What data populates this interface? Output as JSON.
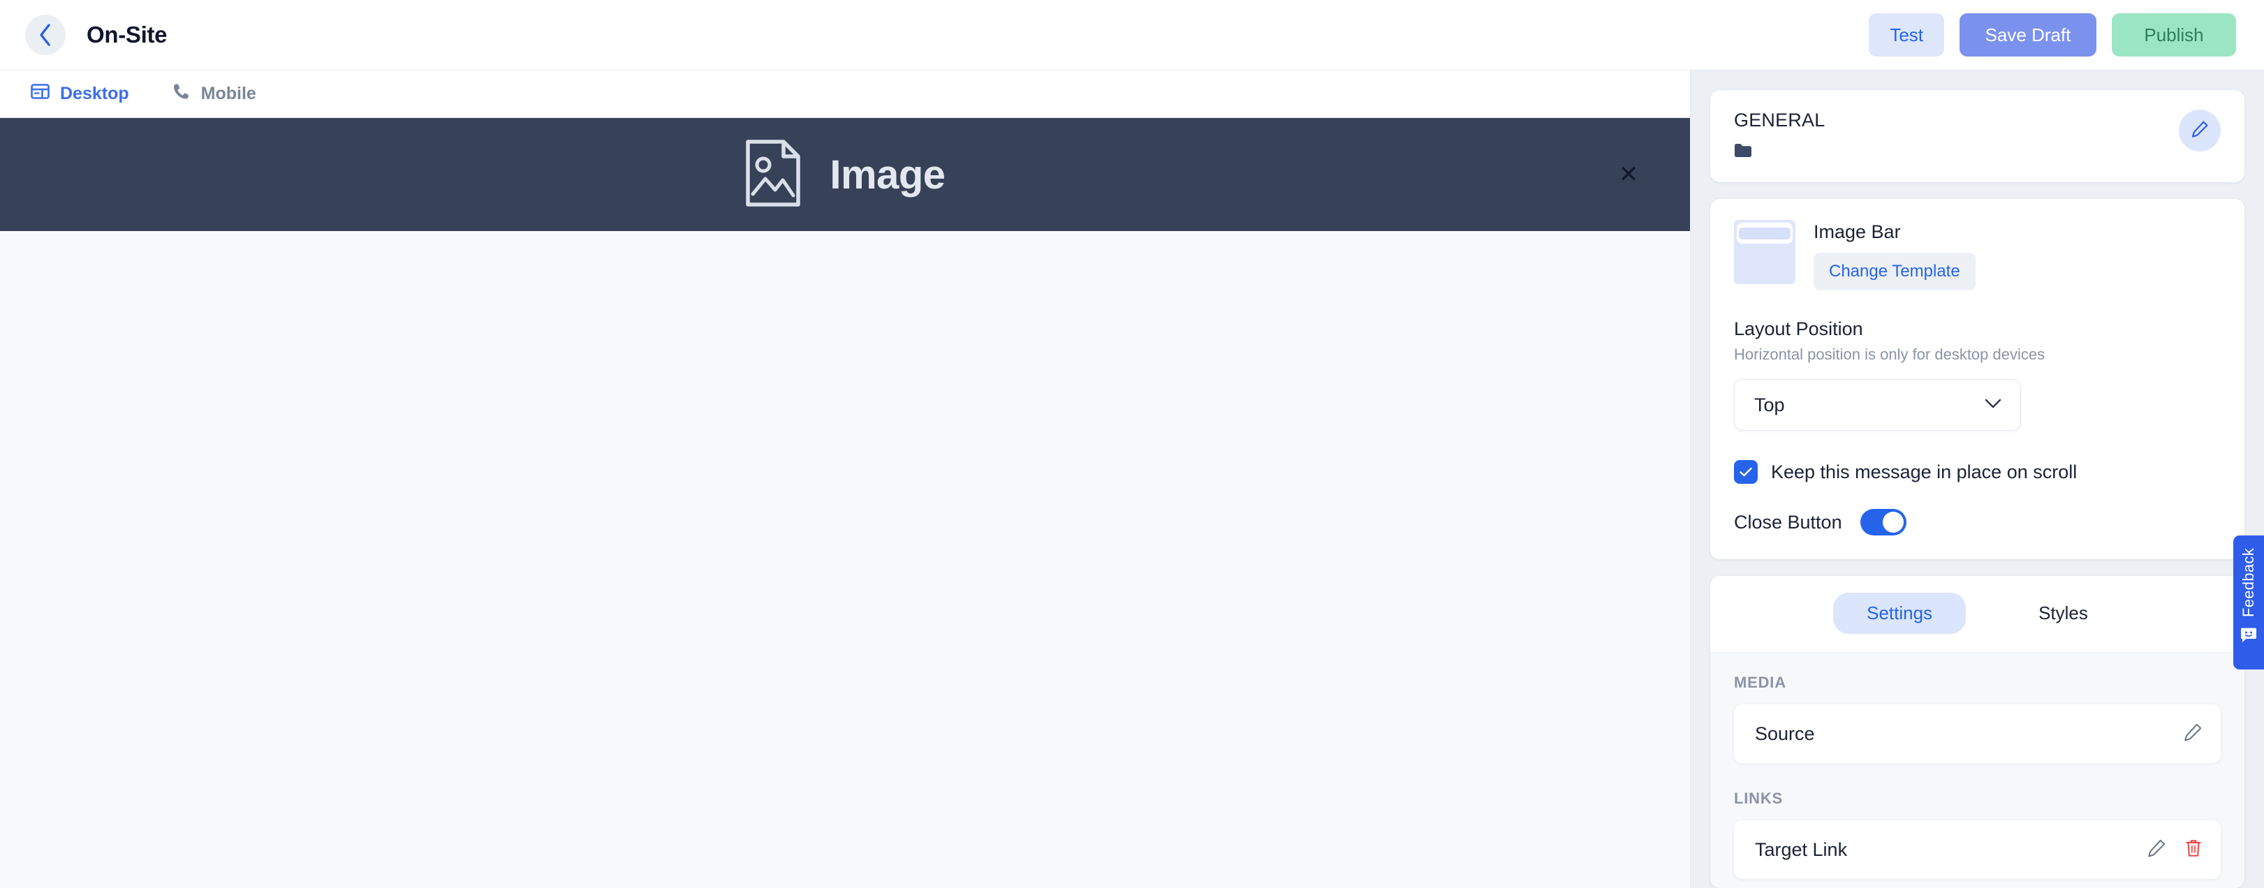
{
  "topbar": {
    "back_icon": "chevron-left-icon",
    "title": "On-Site",
    "buttons": {
      "test": "Test",
      "save_draft": "Save Draft",
      "publish": "Publish"
    }
  },
  "device_tabs": [
    {
      "label": "Desktop",
      "icon": "desktop-icon",
      "active": true
    },
    {
      "label": "Mobile",
      "icon": "phone-icon",
      "active": false
    }
  ],
  "preview": {
    "bar_label": "Image",
    "bar_icon": "image-placeholder-icon",
    "close_icon": "close-icon",
    "bar_background": "#374258",
    "canvas_background": "#f8f9fb"
  },
  "panel": {
    "general": {
      "title": "GENERAL",
      "folder_icon": "folder-icon",
      "edit_icon": "pencil-icon"
    },
    "template": {
      "name": "Image Bar",
      "change_button": "Change Template",
      "thumbnail_icon": "template-thumbnail"
    },
    "layout": {
      "label": "Layout Position",
      "sublabel": "Horizontal position is only for desktop devices",
      "select_value": "Top",
      "select_options": [
        "Top"
      ],
      "chevron_icon": "chevron-down-icon"
    },
    "keep_in_place": {
      "label": "Keep this message in place on scroll",
      "checked": true
    },
    "close_button": {
      "label": "Close Button",
      "enabled": true
    },
    "tabs": [
      {
        "label": "Settings",
        "active": true
      },
      {
        "label": "Styles",
        "active": false
      }
    ],
    "sections": [
      {
        "label": "MEDIA",
        "rows": [
          {
            "label": "Source",
            "edit_icon": "pencil-icon",
            "has_delete": false
          }
        ]
      },
      {
        "label": "LINKS",
        "rows": [
          {
            "label": "Target Link",
            "edit_icon": "pencil-icon",
            "has_delete": true,
            "delete_icon": "trash-icon"
          }
        ]
      }
    ]
  },
  "feedback": {
    "label": "Feedback",
    "icon": "chat-smiley-icon",
    "color": "#2f5dea"
  },
  "colors": {
    "accent_blue": "#2563eb",
    "save_blue": "#7b91ee",
    "publish_green": "#9ae6c4",
    "bar_navy": "#374258",
    "panel_bg": "#eceff3",
    "danger_red": "#ef4444"
  }
}
